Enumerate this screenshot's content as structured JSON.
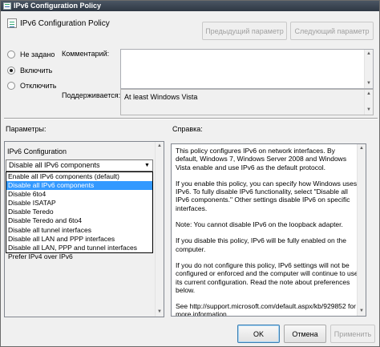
{
  "window": {
    "title": "IPv6 Configuration Policy"
  },
  "header": {
    "title": "IPv6 Configuration Policy",
    "prev_button": "Предыдущий параметр",
    "next_button": "Следующий параметр"
  },
  "state_options": [
    {
      "label": "Не задано",
      "checked": false
    },
    {
      "label": "Включить",
      "checked": true
    },
    {
      "label": "Отключить",
      "checked": false
    }
  ],
  "comment": {
    "label": "Комментарий:",
    "value": ""
  },
  "supported": {
    "label": "Поддерживается:",
    "value": "At least Windows Vista"
  },
  "params": {
    "label": "Параметры:",
    "field_label": "IPv6 Configuration",
    "selected": "Disable all IPv6 components",
    "options": [
      "Enable all IPv6 components (default)",
      "Disable all IPv6 components",
      "Disable 6to4",
      "Disable ISATAP",
      "Disable Teredo",
      "Disable Teredo and 6to4",
      "Disable all tunnel interfaces",
      "Disable all LAN and PPP interfaces",
      "Disable all LAN, PPP and tunnel interfaces",
      "Prefer IPv4 over IPv6"
    ],
    "highlighted_index": 1
  },
  "help": {
    "label": "Справка:",
    "paragraphs": [
      "This policy configures IPv6 on network interfaces.  By default, Windows 7, Windows Server 2008 and Windows Vista enable and use IPv6 as the default protocol.",
      "If you enable this policy, you can specify how Windows uses IPv6. To fully disable IPv6 functionality, select \"Disable all IPv6 components.\"  Other settings disable IPv6 on specific interfaces.",
      "Note: You cannot disable IPv6 on the loopback adapter.",
      "If you disable this policy, IPv6 will be fully enabled on the computer.",
      "If you do not configure this policy, IPv6 settings will not be configured or enforced and the computer will continue to use its current configuration.  Read the note about preferences below.",
      "See http://support.microsoft.com/default.aspx/kb/929852 for more information."
    ]
  },
  "footer": {
    "ok": "OK",
    "cancel": "Отмена",
    "apply": "Применить"
  }
}
